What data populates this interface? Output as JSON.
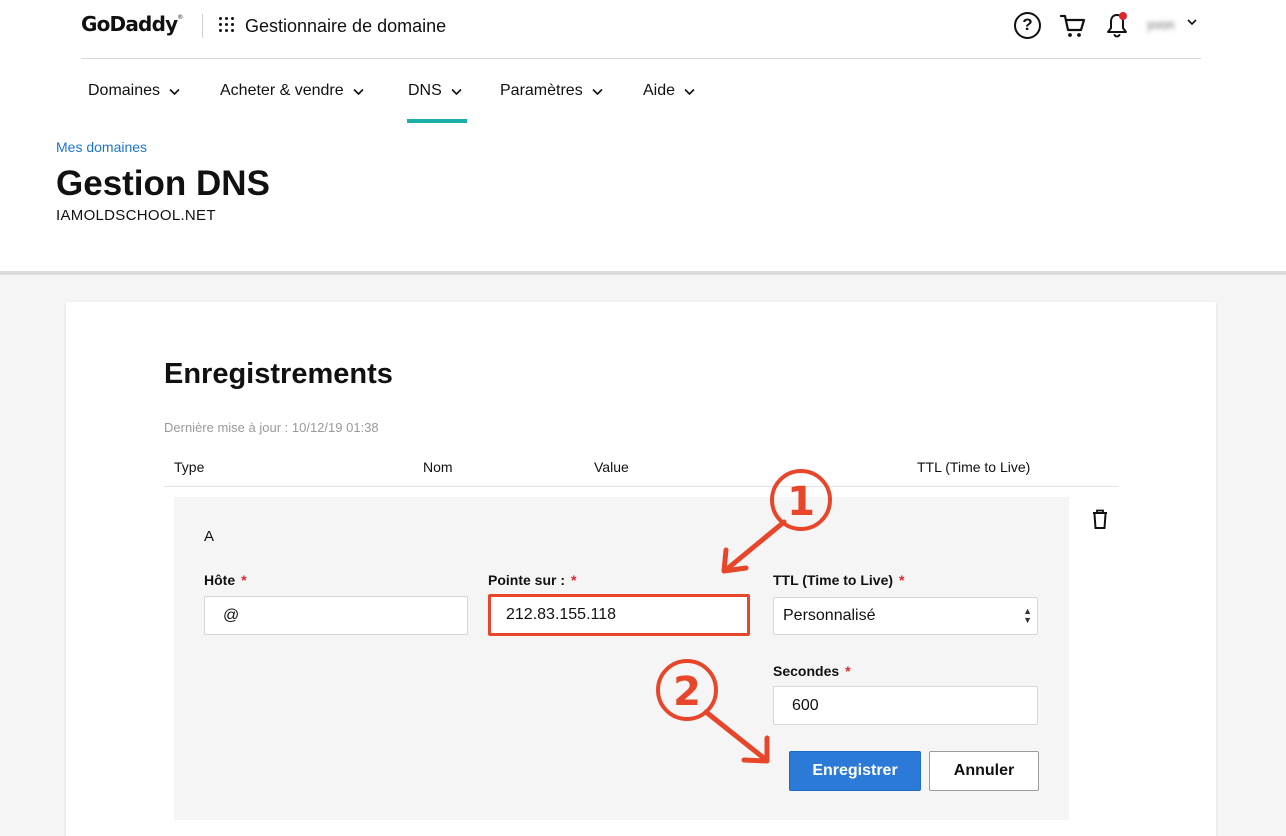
{
  "header": {
    "logo": "GoDaddy",
    "logo_mark": "®",
    "app_title": "Gestionnaire de domaine",
    "help_glyph": "?",
    "user_name": "yvon"
  },
  "nav": {
    "items": [
      {
        "label": "Domaines"
      },
      {
        "label": "Acheter & vendre"
      },
      {
        "label": "DNS",
        "active": true
      },
      {
        "label": "Paramètres"
      },
      {
        "label": "Aide"
      }
    ],
    "active_color": "#1bb0a7"
  },
  "breadcrumb": "Mes domaines",
  "page": {
    "title": "Gestion DNS",
    "domain": "IAMOLDSCHOOL.NET"
  },
  "records": {
    "title": "Enregistrements",
    "last_update": "Dernière mise à jour : 10/12/19 01:38",
    "columns": [
      "Type",
      "Nom",
      "Value",
      "TTL (Time to Live)"
    ]
  },
  "edit": {
    "type": "A",
    "host_label": "Hôte",
    "host_value": "@",
    "points_to_label": "Pointe sur :",
    "points_to_value": "212.83.155.118",
    "ttl_label": "TTL (Time to Live)",
    "ttl_value": "Personnalisé",
    "seconds_label": "Secondes",
    "seconds_value": "600",
    "required_mark": "*",
    "save_label": "Enregistrer",
    "cancel_label": "Annuler"
  },
  "annotations": {
    "step1": "1",
    "step2": "2",
    "color": "#e8462a"
  },
  "colors": {
    "link": "#1976d2",
    "primary_button": "#2b7ad8",
    "required": "#e0252e"
  }
}
